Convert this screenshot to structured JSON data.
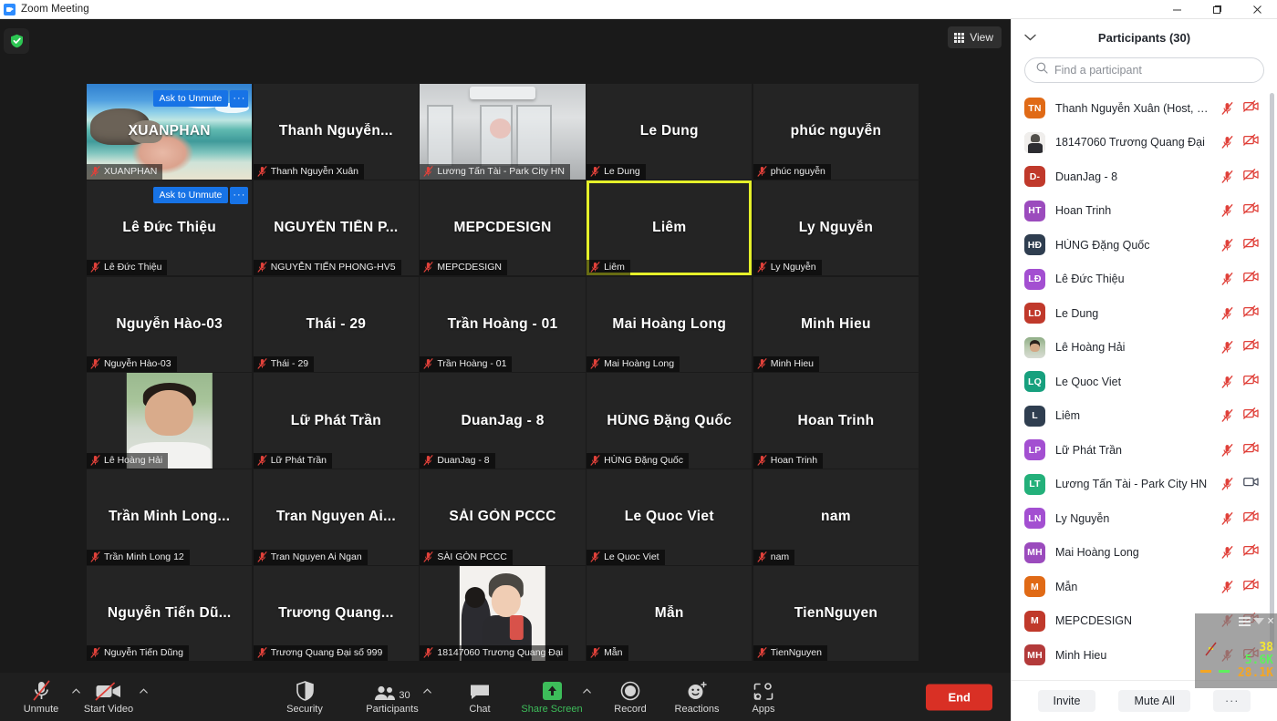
{
  "window": {
    "title": "Zoom Meeting",
    "logo_icon": "zoom-logo-icon",
    "minimize_icon": "minimize-icon",
    "maximize_icon": "restore-icon",
    "close_icon": "close-icon"
  },
  "meeting": {
    "shield_icon": "security-shield-icon",
    "view_button": {
      "label": "View",
      "icon": "grid-view-icon"
    },
    "active_speaker": "Liêm",
    "tiles": [
      {
        "display": "XUANPHAN",
        "footer": "XUANPHAN",
        "muted": true,
        "video": "beach",
        "ask_to_unmute": "Ask to Unmute",
        "more": "···"
      },
      {
        "display": "Thanh Nguyễn...",
        "footer": "Thanh Nguyễn Xuân",
        "muted": true,
        "video": "none"
      },
      {
        "display": "",
        "footer": "Lương Tấn Tài - Park City HN",
        "muted": true,
        "video": "office"
      },
      {
        "display": "Le Dung",
        "footer": "Le Dung",
        "muted": true,
        "video": "none"
      },
      {
        "display": "phúc nguyễn",
        "footer": "phúc nguyễn",
        "muted": true,
        "video": "none"
      },
      {
        "display": "Lê Đức Thiệu",
        "footer": "Lê Đức Thiệu",
        "muted": true,
        "video": "none",
        "ask_to_unmute": "Ask to Unmute",
        "more": "···"
      },
      {
        "display": "NGUYỄN TIẾN P...",
        "footer": "NGUYỄN TIẾN PHONG-HV5",
        "muted": true,
        "video": "none"
      },
      {
        "display": "MEPCDESIGN",
        "footer": "MEPCDESIGN",
        "muted": true,
        "video": "none"
      },
      {
        "display": "Liêm",
        "footer": "Liêm",
        "muted": true,
        "video": "none",
        "active": true
      },
      {
        "display": "Ly Nguyễn",
        "footer": "Ly Nguyễn",
        "muted": true,
        "video": "none"
      },
      {
        "display": "Nguyễn Hào-03",
        "footer": "Nguyễn Hào-03",
        "muted": true,
        "video": "none"
      },
      {
        "display": "Thái - 29",
        "footer": "Thái - 29",
        "muted": true,
        "video": "none"
      },
      {
        "display": "Trần Hoàng - 01",
        "footer": "Trần Hoàng - 01",
        "muted": true,
        "video": "none"
      },
      {
        "display": "Mai Hoàng Long",
        "footer": "Mai Hoàng Long",
        "muted": true,
        "video": "none"
      },
      {
        "display": "Minh Hieu",
        "footer": "Minh Hieu",
        "muted": true,
        "video": "none"
      },
      {
        "display": "",
        "footer": "Lê Hoàng Hải",
        "muted": true,
        "video": "portrait-hh"
      },
      {
        "display": "Lữ Phát Trần",
        "footer": "Lữ Phát Trần",
        "muted": true,
        "video": "none"
      },
      {
        "display": "DuanJag - 8",
        "footer": "DuanJag - 8",
        "muted": true,
        "video": "none"
      },
      {
        "display": "HÙNG Đặng Quốc",
        "footer": "HÙNG Đặng Quốc",
        "muted": true,
        "video": "none"
      },
      {
        "display": "Hoan Trinh",
        "footer": "Hoan Trinh",
        "muted": true,
        "video": "none"
      },
      {
        "display": "Trần Minh Long...",
        "footer": "Trần Minh Long 12",
        "muted": true,
        "video": "none"
      },
      {
        "display": "Tran Nguyen Ai...",
        "footer": "Tran Nguyen Ai Ngan",
        "muted": true,
        "video": "none"
      },
      {
        "display": "SÀI GÒN PCCC",
        "footer": "SÀI GÒN PCCC",
        "muted": true,
        "video": "none"
      },
      {
        "display": "Le Quoc Viet",
        "footer": "Le Quoc Viet",
        "muted": true,
        "video": "none"
      },
      {
        "display": "nam",
        "footer": "nam",
        "muted": true,
        "video": "none"
      },
      {
        "display": "Nguyễn Tiến Dũ...",
        "footer": "Nguyễn Tiến Dũng",
        "muted": true,
        "video": "none"
      },
      {
        "display": "Trương Quang...",
        "footer": "Trương Quang Đại số 999",
        "muted": true,
        "video": "none"
      },
      {
        "display": "",
        "footer": "18147060 Trương Quang Đại",
        "muted": true,
        "video": "portrait-tqd"
      },
      {
        "display": "Mẫn",
        "footer": "Mẫn",
        "muted": true,
        "video": "none"
      },
      {
        "display": "TienNguyen",
        "footer": "TienNguyen",
        "muted": true,
        "video": "none"
      }
    ]
  },
  "toolbar": {
    "items": [
      {
        "label": "Unmute",
        "icon": "mic-off-icon",
        "caret": true,
        "active_color": ""
      },
      {
        "label": "Start Video",
        "icon": "video-off-icon",
        "caret": true,
        "active_color": ""
      },
      {
        "label": "Security",
        "icon": "shield-icon",
        "caret": false,
        "active_color": ""
      },
      {
        "label": "Participants",
        "icon": "participants-icon",
        "caret": true,
        "count": "30",
        "active_color": ""
      },
      {
        "label": "Chat",
        "icon": "chat-icon",
        "caret": false,
        "active_color": ""
      },
      {
        "label": "Share Screen",
        "icon": "share-screen-icon",
        "caret": true,
        "active_color": "#3dbd5a"
      },
      {
        "label": "Record",
        "icon": "record-icon",
        "caret": false,
        "active_color": ""
      },
      {
        "label": "Reactions",
        "icon": "reactions-icon",
        "caret": false,
        "active_color": ""
      },
      {
        "label": "Apps",
        "icon": "apps-icon",
        "caret": false,
        "active_color": ""
      }
    ],
    "end_button": "End"
  },
  "panel": {
    "chevron_icon": "chevron-down-icon",
    "title": "Participants (30)",
    "search": {
      "placeholder": "Find a participant",
      "value": "",
      "icon": "search-icon"
    },
    "participants": [
      {
        "name": "Thanh Nguyễn Xuân (Host, me)",
        "initials": "TN",
        "color": "#e06a16",
        "photo": "",
        "mic": "muted",
        "cam": "off"
      },
      {
        "name": "18147060 Trương Quang Đại",
        "initials": "",
        "color": "",
        "photo": "tqd",
        "mic": "muted",
        "cam": "off"
      },
      {
        "name": "DuanJag - 8",
        "initials": "D-",
        "color": "#c0392b",
        "photo": "",
        "mic": "muted",
        "cam": "off"
      },
      {
        "name": "Hoan Trinh",
        "initials": "HT",
        "color": "#9b4bbd",
        "photo": "",
        "mic": "muted",
        "cam": "off"
      },
      {
        "name": "HÙNG Đặng Quốc",
        "initials": "HĐ",
        "color": "#2f3e50",
        "photo": "",
        "mic": "muted",
        "cam": "off"
      },
      {
        "name": "Lê Đức Thiệu",
        "initials": "LĐ",
        "color": "#a34fd1",
        "photo": "",
        "mic": "muted",
        "cam": "off"
      },
      {
        "name": "Le Dung",
        "initials": "LD",
        "color": "#c0392b",
        "photo": "",
        "mic": "muted",
        "cam": "off"
      },
      {
        "name": "Lê Hoàng Hải",
        "initials": "",
        "color": "",
        "photo": "hh",
        "mic": "muted",
        "cam": "off"
      },
      {
        "name": "Le Quoc Viet",
        "initials": "LQ",
        "color": "#17a07e",
        "photo": "",
        "mic": "muted",
        "cam": "off"
      },
      {
        "name": "Liêm",
        "initials": "L",
        "color": "#2f3e50",
        "photo": "",
        "mic": "muted",
        "cam": "off"
      },
      {
        "name": "Lữ Phát Trần",
        "initials": "LP",
        "color": "#a34fd1",
        "photo": "",
        "mic": "muted",
        "cam": "off"
      },
      {
        "name": "Lương Tấn Tài - Park City HN",
        "initials": "LT",
        "color": "#23b07a",
        "photo": "",
        "mic": "muted",
        "cam": "on"
      },
      {
        "name": "Ly Nguyễn",
        "initials": "LN",
        "color": "#a34fd1",
        "photo": "",
        "mic": "muted",
        "cam": "off"
      },
      {
        "name": "Mai Hoàng Long",
        "initials": "MH",
        "color": "#9b4bbd",
        "photo": "",
        "mic": "muted",
        "cam": "off"
      },
      {
        "name": "Mẫn",
        "initials": "M",
        "color": "#e06a16",
        "photo": "",
        "mic": "muted",
        "cam": "off"
      },
      {
        "name": "MEPCDESIGN",
        "initials": "M",
        "color": "#c0392b",
        "photo": "",
        "mic": "muted",
        "cam": "off"
      },
      {
        "name": "Minh Hieu",
        "initials": "MH",
        "color": "#b33a3a",
        "photo": "",
        "mic": "muted",
        "cam": "off"
      }
    ],
    "footer": {
      "invite": "Invite",
      "mute_all": "Mute All",
      "more": "···"
    }
  },
  "stats_overlay": {
    "value1": "38",
    "value2": "5.6K",
    "value3": "28.1K",
    "close_icon": "close-icon",
    "menu_icon": "hamburger-icon",
    "filter_icon": "filter-icon"
  }
}
